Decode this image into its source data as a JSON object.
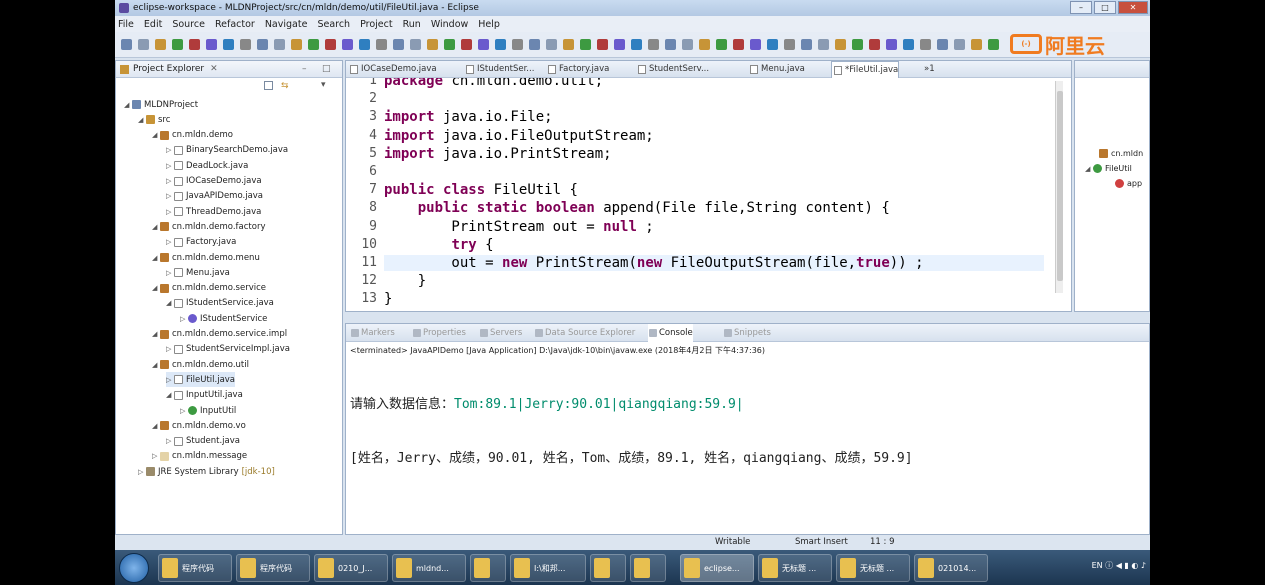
{
  "window": {
    "title": "eclipse-workspace - MLDNProject/src/cn/mldn/demo/util/FileUtil.java - Eclipse"
  },
  "menu": [
    "File",
    "Edit",
    "Source",
    "Refactor",
    "Navigate",
    "Search",
    "Project",
    "Run",
    "Window",
    "Help"
  ],
  "logo": {
    "box_text": "(-)",
    "text": "阿里云"
  },
  "project_explorer": {
    "title": "Project Explorer",
    "nodes": [
      {
        "label": "MLDNProject",
        "icon": "project-icon"
      },
      {
        "label": "src",
        "icon": "source-folder-icon"
      },
      {
        "label": "cn.mldn.demo",
        "icon": "package-icon"
      },
      {
        "label": "BinarySearchDemo.java",
        "icon": "java-file-icon"
      },
      {
        "label": "DeadLock.java",
        "icon": "java-file-icon"
      },
      {
        "label": "IOCaseDemo.java",
        "icon": "java-file-icon"
      },
      {
        "label": "JavaAPIDemo.java",
        "icon": "java-file-icon"
      },
      {
        "label": "ThreadDemo.java",
        "icon": "java-file-icon"
      },
      {
        "label": "cn.mldn.demo.factory",
        "icon": "package-icon"
      },
      {
        "label": "Factory.java",
        "icon": "java-file-icon"
      },
      {
        "label": "cn.mldn.demo.menu",
        "icon": "package-icon"
      },
      {
        "label": "Menu.java",
        "icon": "java-file-icon"
      },
      {
        "label": "cn.mldn.demo.service",
        "icon": "package-icon"
      },
      {
        "label": "IStudentService.java",
        "icon": "java-file-icon"
      },
      {
        "label": "IStudentService",
        "icon": "interface-icon"
      },
      {
        "label": "cn.mldn.demo.service.impl",
        "icon": "package-icon"
      },
      {
        "label": "StudentServiceImpl.java",
        "icon": "java-file-icon"
      },
      {
        "label": "cn.mldn.demo.util",
        "icon": "package-icon"
      },
      {
        "label": "FileUtil.java",
        "icon": "java-file-icon"
      },
      {
        "label": "InputUtil.java",
        "icon": "java-file-icon"
      },
      {
        "label": "InputUtil",
        "icon": "class-icon"
      },
      {
        "label": "cn.mldn.demo.vo",
        "icon": "package-icon"
      },
      {
        "label": "Student.java",
        "icon": "java-file-icon"
      },
      {
        "label": "cn.mldn.message",
        "icon": "empty-package-icon"
      },
      {
        "label": "JRE System Library",
        "suffix": "[jdk-10]",
        "icon": "library-icon"
      }
    ]
  },
  "editor": {
    "tabs": [
      "IOCaseDemo.java",
      "IStudentSer...",
      "Factory.java",
      "StudentServ...",
      "Menu.java",
      "*FileUtil.java",
      "»1"
    ],
    "lines": [
      {
        "n": "1",
        "parts": [
          [
            "kw",
            "package"
          ],
          [
            "",
            " cn.mldn.demo.util;"
          ]
        ]
      },
      {
        "n": "2",
        "parts": [
          [
            "",
            ""
          ]
        ]
      },
      {
        "n": "3",
        "parts": [
          [
            "kw",
            "import"
          ],
          [
            "",
            " java.io.File;"
          ]
        ]
      },
      {
        "n": "4",
        "parts": [
          [
            "kw",
            "import"
          ],
          [
            "",
            " java.io.FileOutputStream;"
          ]
        ]
      },
      {
        "n": "5",
        "parts": [
          [
            "kw",
            "import"
          ],
          [
            "",
            " java.io.PrintStream;"
          ]
        ]
      },
      {
        "n": "6",
        "parts": [
          [
            "",
            ""
          ]
        ]
      },
      {
        "n": "7",
        "parts": [
          [
            "kw",
            "public"
          ],
          [
            "",
            " "
          ],
          [
            "kw",
            "class"
          ],
          [
            "",
            " FileUtil {"
          ]
        ]
      },
      {
        "n": "8",
        "parts": [
          [
            "",
            "    "
          ],
          [
            "kw",
            "public"
          ],
          [
            "",
            " "
          ],
          [
            "kw",
            "static"
          ],
          [
            "",
            " "
          ],
          [
            "kw",
            "boolean"
          ],
          [
            "",
            " append(File file,String content) {"
          ]
        ]
      },
      {
        "n": "9",
        "parts": [
          [
            "",
            "        PrintStream out = "
          ],
          [
            "kw",
            "null"
          ],
          [
            "",
            " ;"
          ]
        ]
      },
      {
        "n": "10",
        "parts": [
          [
            "",
            "        "
          ],
          [
            "kw",
            "try"
          ],
          [
            "",
            " {"
          ]
        ]
      },
      {
        "n": "11",
        "parts": [
          [
            "",
            "        out = "
          ],
          [
            "kw",
            "new"
          ],
          [
            "",
            " PrintStream("
          ],
          [
            "kw",
            "new"
          ],
          [
            "",
            " FileOutputStream(file,"
          ],
          [
            "kw",
            "true"
          ],
          [
            "",
            ")) ;"
          ]
        ]
      },
      {
        "n": "12",
        "parts": [
          [
            "",
            "    }"
          ]
        ]
      },
      {
        "n": "13",
        "parts": [
          [
            "",
            "}"
          ]
        ]
      }
    ]
  },
  "outline": {
    "items": [
      "cn.mldn",
      "FileUtil",
      "app"
    ]
  },
  "console": {
    "tabs": [
      "Markers",
      "Properties",
      "Servers",
      "Data Source Explorer",
      "Console",
      "Snippets"
    ],
    "info": "<terminated> JavaAPIDemo [Java Application] D:\\Java\\jdk-10\\bin\\javaw.exe (2018年4月2日 下午4:37:36)",
    "prompt": "请输入数据信息：",
    "input": "Tom:89.1|Jerry:90.01|qiangqiang:59.9|",
    "output": "[姓名，Jerry、成绩，90.01, 姓名，Tom、成绩，89.1, 姓名，qiangqiang、成绩，59.9]"
  },
  "status": {
    "writable": "Writable",
    "insert": "Smart Insert",
    "position": "11 : 9"
  },
  "taskbar": {
    "buttons": [
      "程序代码",
      "程序代码",
      "0210_J...",
      "mldnd...",
      "",
      "I:\\和邦...",
      "",
      "",
      "eclipse...",
      "无标题 ...",
      "无标题 ...",
      "021014..."
    ],
    "tray": "EN"
  },
  "colors": {
    "keyword": "#7f0055",
    "console_input": "#008c6c",
    "logo": "#f07b20"
  }
}
